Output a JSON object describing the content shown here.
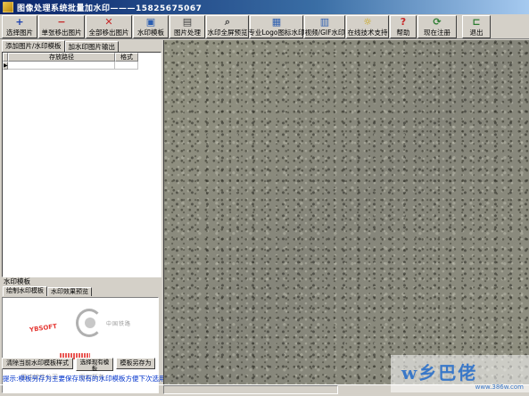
{
  "window": {
    "title": "图像处理系统批量加水印———15825675067"
  },
  "toolbar": {
    "buttons": [
      {
        "label": "选择图片",
        "icon": "plus-icon",
        "glyph": "+",
        "color": "#1a3fb0"
      },
      {
        "label": "单张移出图片",
        "icon": "minus-icon",
        "glyph": "−",
        "color": "#c62828"
      },
      {
        "label": "全部移出图片",
        "icon": "cross-icon",
        "glyph": "✕",
        "color": "#c62828"
      },
      {
        "label": "水印模板",
        "icon": "save-icon",
        "glyph": "▣",
        "color": "#2a5db0"
      },
      {
        "label": "图片处理",
        "icon": "document-icon",
        "glyph": "▤",
        "color": "#444444"
      },
      {
        "label": "水印全屏预览",
        "icon": "magnify-icon",
        "glyph": "⌕",
        "color": "#444444"
      },
      {
        "label": "专业Logo图标水印",
        "icon": "image-icon",
        "glyph": "▦",
        "color": "#2a5db0"
      },
      {
        "label": "视频/GIF水印",
        "icon": "film-icon",
        "glyph": "▥",
        "color": "#2a5db0"
      },
      {
        "label": "在线技术支持",
        "icon": "lightbulb-icon",
        "glyph": "☼",
        "color": "#c8a000"
      },
      {
        "label": "帮助",
        "icon": "help-icon",
        "glyph": "?",
        "color": "#c62828"
      },
      {
        "label": "现在注册",
        "icon": "refresh-icon",
        "glyph": "⟳",
        "color": "#2e7d32"
      },
      {
        "label": "退出",
        "icon": "exit-icon",
        "glyph": "⊏",
        "color": "#2e7d32"
      }
    ]
  },
  "left_tabs": {
    "tab1": "添加图片/水印模板",
    "tab2": "加水印图片输出"
  },
  "grid": {
    "col_path": "存放路径",
    "col_format": "格式",
    "row_marker": "▶"
  },
  "watermark": {
    "section_label": "水印模板",
    "tab1": "绘制水印模板",
    "tab2": "水印效果预览",
    "preview": {
      "red_text": "YBSOFT",
      "logo_text": "中国铁路",
      "company_left": "易达软件公司",
      "company_right": "版权所有"
    }
  },
  "buttons": {
    "clear": "清除当前水印模板样式",
    "select": "选择现有模板",
    "save_as": "模板另存为"
  },
  "hint": "提示:模板另存为主要保存现有的水印模板方便下次选用",
  "site_watermark": {
    "text": "w乡巴佬",
    "url": "www.386w.com",
    "color": "#3a78c8"
  }
}
